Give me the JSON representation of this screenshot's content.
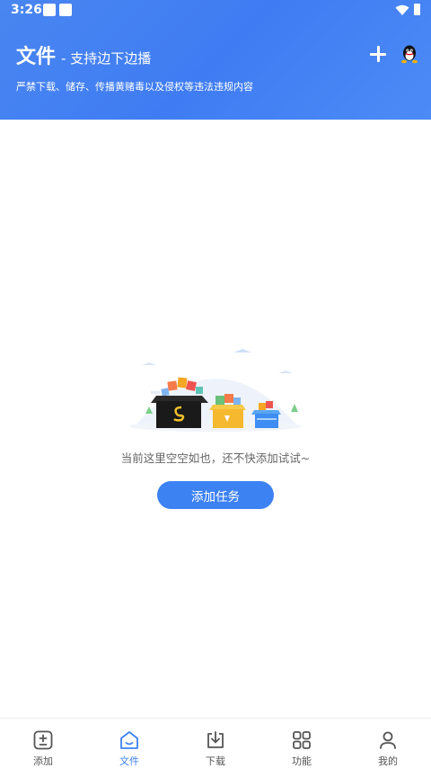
{
  "status": {
    "time": "3:26"
  },
  "header": {
    "title": "文件",
    "subtitle": "- 支持边下边播",
    "notice": "严禁下载、储存、传播黄赌毒以及侵权等违法违规内容"
  },
  "empty_state": {
    "message": "当前这里空空如也，还不快添加试试~",
    "action_label": "添加任务"
  },
  "tabs": [
    {
      "label": "添加",
      "icon": "add-box-icon",
      "active": false
    },
    {
      "label": "文件",
      "icon": "home-icon",
      "active": true
    },
    {
      "label": "下载",
      "icon": "download-icon",
      "active": false
    },
    {
      "label": "功能",
      "icon": "grid-icon",
      "active": false
    },
    {
      "label": "我的",
      "icon": "profile-icon",
      "active": false
    }
  ],
  "colors": {
    "accent": "#3d82f3",
    "header_bg": "#4a86f0"
  }
}
